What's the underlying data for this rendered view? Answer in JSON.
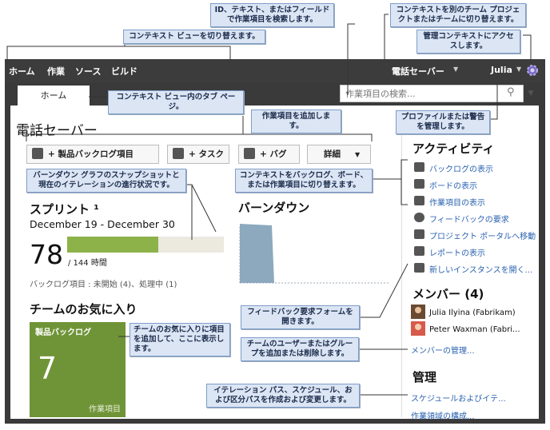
{
  "callouts": {
    "switch_context_view": "コンテキスト  ビューを切り替えます。",
    "search": "ID、テキスト、またはフィールドで作業項目を検索します。",
    "switch_project": "コンテキストを別のチーム  プロジェクトまたはチームに切り替えます。",
    "admin_context": "管理コンテキストにアクセスします。",
    "tab_page": "コンテキスト  ビュー内のタブ  ページ。",
    "profile_alert": "プロファイルまたは警告を管理します。",
    "add_work_item": "作業項目を追加します。",
    "burndown_snapshot": "バーンダウン  グラフのスナップショットと現在のイテレーションの進行状況です。",
    "switch_backlog": "コンテキストをバックログ、ボード、または作業項目に切り替えます。",
    "feedback_form": "フィードバック要求フォームを開きます。",
    "team_favorites": "チームのお気に入りに項目を追加して、ここに表示します。",
    "team_members": "チームのユーザーまたはグループを追加または削除します。",
    "iteration_paths": "イテレーション  パス、スケジュール、および区分パスを作成および変更します。"
  },
  "topnav": {
    "items": [
      "ホーム",
      "作業",
      "ソース",
      "ビルド"
    ],
    "project": "電話セーバー",
    "user": "Julia"
  },
  "tab": {
    "home": "ホーム"
  },
  "search": {
    "placeholder": "作業項目の検索..."
  },
  "main": {
    "title": "電話セーバー",
    "buttons": {
      "backlog_item": "+ 製品バックログ項目",
      "task": "+ タスク",
      "bug": "+ バグ",
      "more": "詳細"
    },
    "sprint": {
      "title": "スプリント ¹",
      "dates": "December 19 - December 30",
      "remaining": "78",
      "total": "/ 144 時間",
      "progress": 0.58,
      "backlog_status": "バックログ項目 : 未開始 (4)、処理中 (1)"
    },
    "burndown": {
      "title": "バーンダウン"
    },
    "favorites": {
      "title": "チームのお気に入り",
      "tile_title": "製品バックログ",
      "tile_count": "7",
      "tile_label": "作業項目"
    }
  },
  "sidebar": {
    "activities_title": "アクティビティ",
    "activities": [
      {
        "label": "バックログの表示",
        "icon": "list-icon"
      },
      {
        "label": "ボードの表示",
        "icon": "board-icon"
      },
      {
        "label": "作業項目の表示",
        "icon": "grid-icon"
      },
      {
        "label": "フィードバックの要求",
        "icon": "feedback-icon"
      },
      {
        "label": "プロジェクト ポータルへ移動",
        "icon": "portal-icon"
      },
      {
        "label": "レポートの表示",
        "icon": "report-icon"
      },
      {
        "label": "新しいインスタンスを開く...",
        "icon": "portal-icon"
      }
    ],
    "members_title": "メンバー (4)",
    "members": [
      {
        "name": "Julia Ilyina (Fabrikam)"
      },
      {
        "name": "Peter Waxman (Fabri..."
      }
    ],
    "manage_members": "メンバーの管理...",
    "admin_title": "管理",
    "admin_links": [
      "スケジュールおよびイテ...",
      "作業領域の構成..."
    ]
  },
  "colors": {
    "progress": "#8db24a",
    "tile": "#6f9437",
    "burndown": "#8ca9be"
  }
}
